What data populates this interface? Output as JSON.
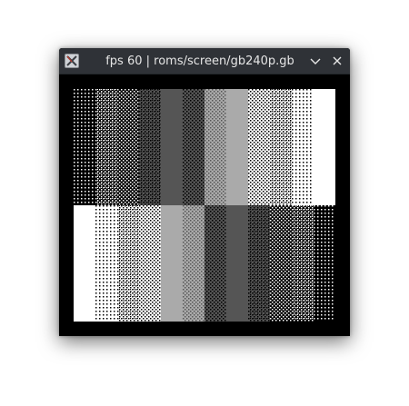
{
  "window": {
    "title": "fps 60 | roms/screen/gb240p.gb",
    "icons": {
      "app": "app-icon",
      "minimize": "chevron-down-icon",
      "close": "close-icon"
    }
  },
  "screen": {
    "top_row": [
      {
        "shade": "#000000",
        "pattern": "dots_light"
      },
      {
        "shade": "#000000",
        "pattern": "dots"
      },
      {
        "shade": "#000000",
        "pattern": "check"
      },
      {
        "shade": "#555555",
        "pattern": "dots"
      },
      {
        "shade": "#555555",
        "pattern": "solid"
      },
      {
        "shade": "#555555",
        "pattern": "check"
      },
      {
        "shade": "#aaaaaa",
        "pattern": "check"
      },
      {
        "shade": "#aaaaaa",
        "pattern": "solid"
      },
      {
        "shade": "#ffffff",
        "pattern": "check"
      },
      {
        "shade": "#ffffff",
        "pattern": "dots"
      },
      {
        "shade": "#ffffff",
        "pattern": "dots_light"
      },
      {
        "shade": "#ffffff",
        "pattern": "solid"
      }
    ],
    "bottom_row": [
      {
        "shade": "#ffffff",
        "pattern": "solid"
      },
      {
        "shade": "#ffffff",
        "pattern": "dots_light"
      },
      {
        "shade": "#ffffff",
        "pattern": "dots"
      },
      {
        "shade": "#ffffff",
        "pattern": "check"
      },
      {
        "shade": "#aaaaaa",
        "pattern": "solid"
      },
      {
        "shade": "#aaaaaa",
        "pattern": "check"
      },
      {
        "shade": "#555555",
        "pattern": "check"
      },
      {
        "shade": "#555555",
        "pattern": "solid"
      },
      {
        "shade": "#555555",
        "pattern": "dots"
      },
      {
        "shade": "#000000",
        "pattern": "check"
      },
      {
        "shade": "#000000",
        "pattern": "dots"
      },
      {
        "shade": "#000000",
        "pattern": "dots_light"
      }
    ]
  }
}
